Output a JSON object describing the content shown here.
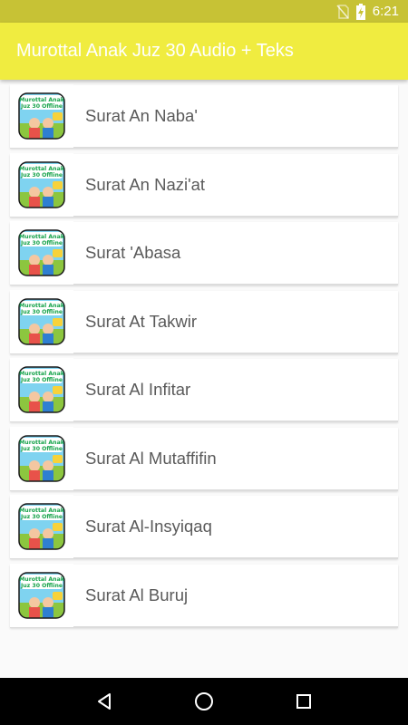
{
  "status_bar": {
    "time": "6:21",
    "icons": [
      "no-sim-icon",
      "battery-charging-icon"
    ]
  },
  "app_bar": {
    "title": "Murottal Anak Juz 30 Audio + Teks"
  },
  "list": {
    "items": [
      {
        "label": "Surat An Naba'",
        "thumb_text": [
          "Murottal Anak",
          "Juz 30 Offline"
        ]
      },
      {
        "label": "Surat An Nazi'at",
        "thumb_text": [
          "Murottal Anak",
          "Juz 30 Offline"
        ]
      },
      {
        "label": "Surat 'Abasa",
        "thumb_text": [
          "Murottal Anak",
          "Juz 30 Offline"
        ]
      },
      {
        "label": "Surat At Takwir",
        "thumb_text": [
          "Murottal Anak",
          "Juz 30 Offline"
        ]
      },
      {
        "label": "Surat Al Infitar",
        "thumb_text": [
          "Murottal Anak",
          "Juz 30 Offline"
        ]
      },
      {
        "label": "Surat Al Mutaffifin",
        "thumb_text": [
          "Murottal Anak",
          "Juz 30 Offline"
        ]
      },
      {
        "label": "Surat Al-Insyiqaq",
        "thumb_text": [
          "Murottal Anak",
          "Juz 30 Offline"
        ]
      },
      {
        "label": "Surat Al Buruj",
        "thumb_text": [
          "Murottal Anak",
          "Juz 30 Offline"
        ]
      }
    ]
  },
  "nav_bar": {
    "icons": [
      "back-icon",
      "home-icon",
      "recents-icon"
    ]
  },
  "colors": {
    "app_bar": "#f0ec40",
    "status_bar": "#c7c235",
    "label_text": "#5a5a5a"
  }
}
